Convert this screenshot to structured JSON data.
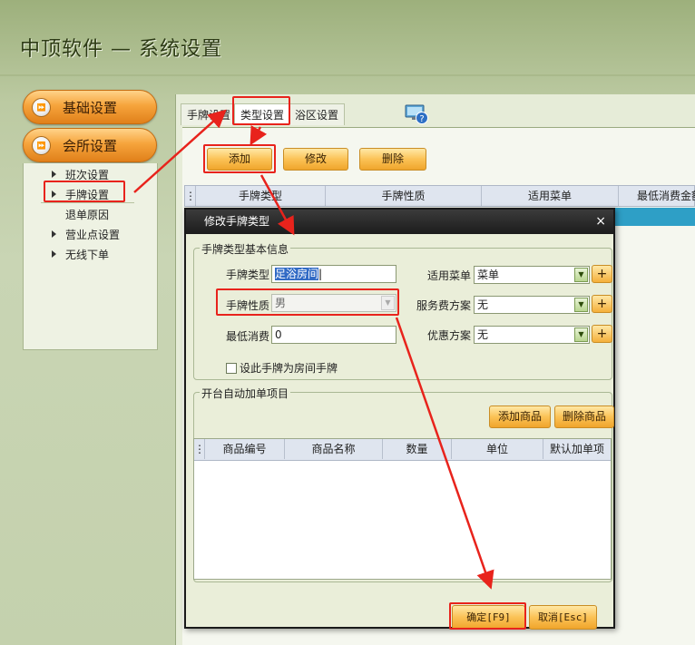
{
  "app": {
    "title": "中顶软件 — 系统设置"
  },
  "sidebar": {
    "sections": [
      {
        "label": "基础设置"
      },
      {
        "label": "会所设置"
      }
    ],
    "items": [
      {
        "label": "班次设置"
      },
      {
        "label": "手牌设置"
      },
      {
        "label": "退单原因"
      },
      {
        "label": "营业点设置"
      },
      {
        "label": "无线下单"
      }
    ],
    "expand_glyph": "⏩"
  },
  "tabs": [
    {
      "label": "手牌设置"
    },
    {
      "label": "类型设置"
    },
    {
      "label": "浴区设置"
    }
  ],
  "toolbar": {
    "add": "添加",
    "edit": "修改",
    "delete": "删除"
  },
  "table": {
    "columns": [
      "手牌类型",
      "手牌性质",
      "适用菜单",
      "最低消费金额"
    ]
  },
  "dialog": {
    "title": "修改手牌类型",
    "close": "×",
    "basic_group": "手牌类型基本信息",
    "fields": {
      "card_type": {
        "label": "手牌类型",
        "value": "足浴房间"
      },
      "card_nature": {
        "label": "手牌性质",
        "value": "男"
      },
      "min_consumption": {
        "label": "最低消费",
        "value": "0"
      },
      "menu": {
        "label": "适用菜单",
        "value": "菜单"
      },
      "service_fee": {
        "label": "服务费方案",
        "value": "无"
      },
      "discount": {
        "label": "优惠方案",
        "value": "无"
      }
    },
    "room_checkbox": {
      "label": "设此手牌为房间手牌",
      "checked": false
    },
    "auto_group": "开台自动加单项目",
    "add_goods": "添加商品",
    "delete_goods": "删除商品",
    "goods_columns": [
      "商品编号",
      "商品名称",
      "数量",
      "单位",
      "默认加单项"
    ],
    "confirm": "确定[F9]",
    "cancel": "取消[Esc]"
  },
  "colors": {
    "accent_orange": "#f6a43c",
    "annotation_red": "#e8231c",
    "selected_row": "#2e9fc6"
  },
  "icons": {
    "help": "monitor-help-icon",
    "dropdown": "▼",
    "plus": "+"
  }
}
